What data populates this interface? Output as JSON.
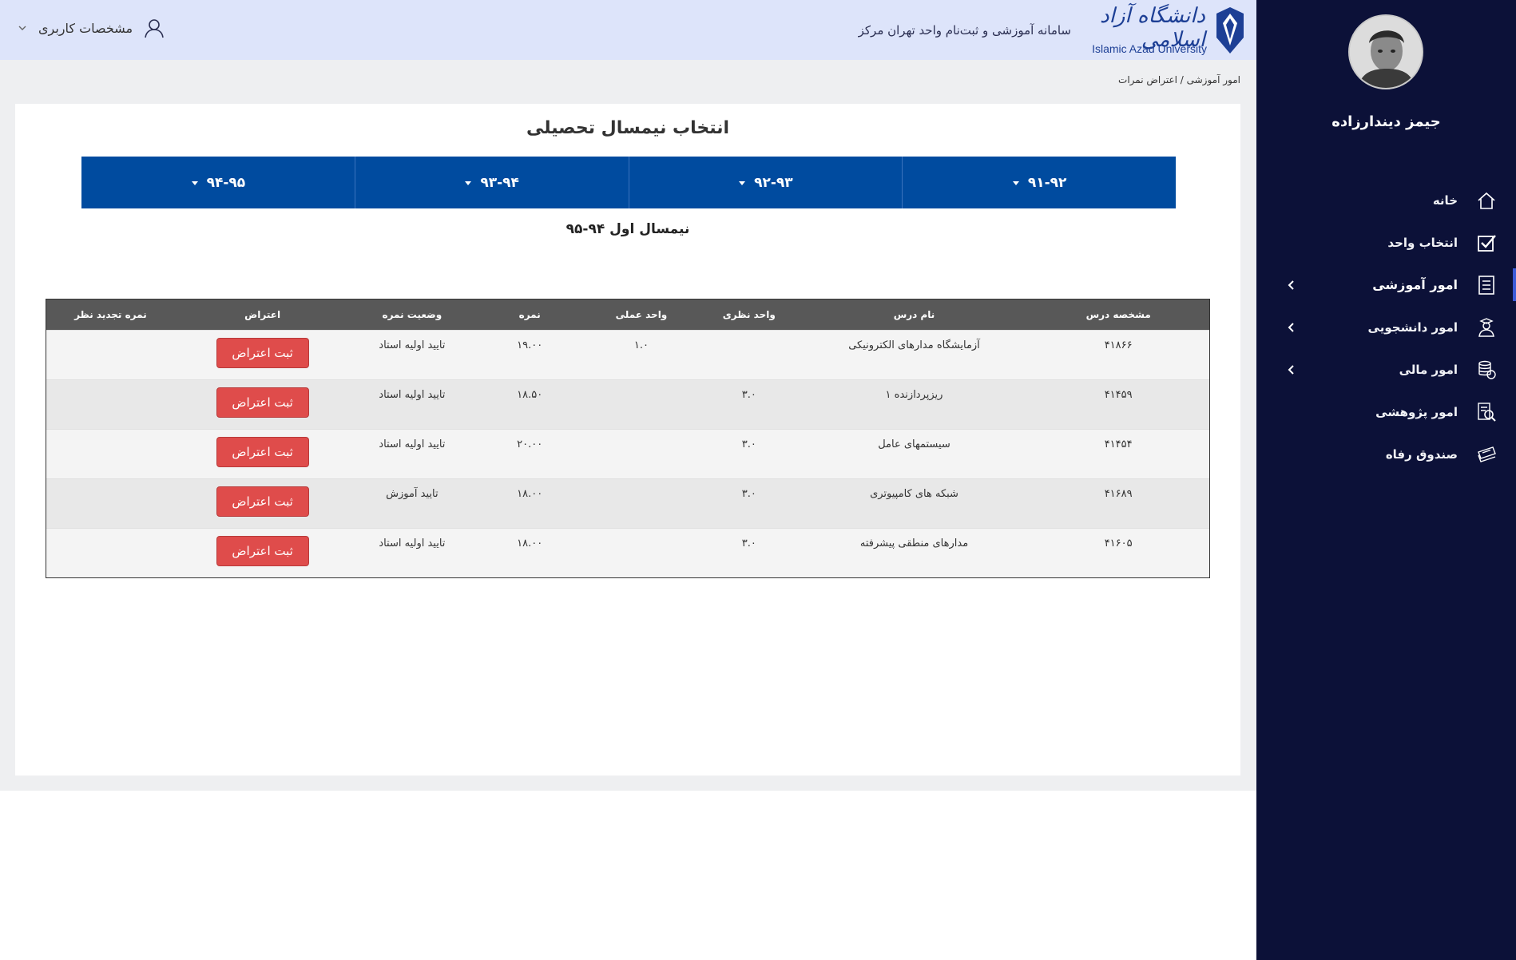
{
  "header": {
    "user_menu_label": "مشخصات کاربری",
    "system_title": "سامانه آموزشی و ثبت‌نام واحد تهران مرکز",
    "logo_fa": "دانشگاه آزاد اسلامی",
    "logo_en": "Islamic Azad University"
  },
  "sidebar": {
    "user_name": "جیمز دیندارزاده",
    "items": [
      {
        "label": "خانه",
        "icon": "home-icon"
      },
      {
        "label": "انتخاب واحد",
        "icon": "checkbox-icon"
      },
      {
        "label": "امور آموزشی",
        "icon": "document-list-icon",
        "active": true
      },
      {
        "label": "امور دانشجویی",
        "icon": "student-icon"
      },
      {
        "label": "امور مالی",
        "icon": "coins-icon"
      },
      {
        "label": "امور پژوهشی",
        "icon": "research-icon"
      },
      {
        "label": "صندوق رفاه",
        "icon": "card-stack-icon"
      }
    ]
  },
  "breadcrumb": "امور آموزشی / اعتراض نمرات",
  "page": {
    "title": "انتخاب نیمسال تحصیلی",
    "years": [
      "۹۱-۹۲",
      "۹۲-۹۳",
      "۹۳-۹۴",
      "۹۴-۹۵"
    ],
    "semester_label": "نیمسال اول ۹۴-۹۵"
  },
  "table": {
    "headers": [
      "مشخصه درس",
      "نام درس",
      "واحد نظری",
      "واحد عملی",
      "نمره",
      "وضعیت نمره",
      "اعتراض",
      "نمره تجدید نظر"
    ],
    "button_label": "ثبت اعتراض",
    "rows": [
      {
        "code": "۴۱۸۶۶",
        "name": "آزمایشگاه مدارهای الکترونیکی",
        "theory": "",
        "practical": "۱.۰",
        "grade": "۱۹.۰۰",
        "status": "تایید اولیه استاد",
        "review": ""
      },
      {
        "code": "۴۱۴۵۹",
        "name": "ریزپردازنده ۱",
        "theory": "۳.۰",
        "practical": "",
        "grade": "۱۸.۵۰",
        "status": "تایید اولیه استاد",
        "review": ""
      },
      {
        "code": "۴۱۴۵۴",
        "name": "سیستمهای عامل",
        "theory": "۳.۰",
        "practical": "",
        "grade": "۲۰.۰۰",
        "status": "تایید اولیه استاد",
        "review": ""
      },
      {
        "code": "۴۱۶۸۹",
        "name": "شبکه های کامپیوتری",
        "theory": "۳.۰",
        "practical": "",
        "grade": "۱۸.۰۰",
        "status": "تایید آموزش",
        "review": ""
      },
      {
        "code": "۴۱۶۰۵",
        "name": "مدارهای منطقی پیشرفته",
        "theory": "۳.۰",
        "practical": "",
        "grade": "۱۸.۰۰",
        "status": "تایید اولیه استاد",
        "review": ""
      }
    ]
  },
  "colors": {
    "sidebar_bg": "#0c1138",
    "header_bg": "#dde4fa",
    "tab_bg": "#004b9f",
    "table_head_bg": "#585858",
    "button_bg": "#df4c4b"
  }
}
